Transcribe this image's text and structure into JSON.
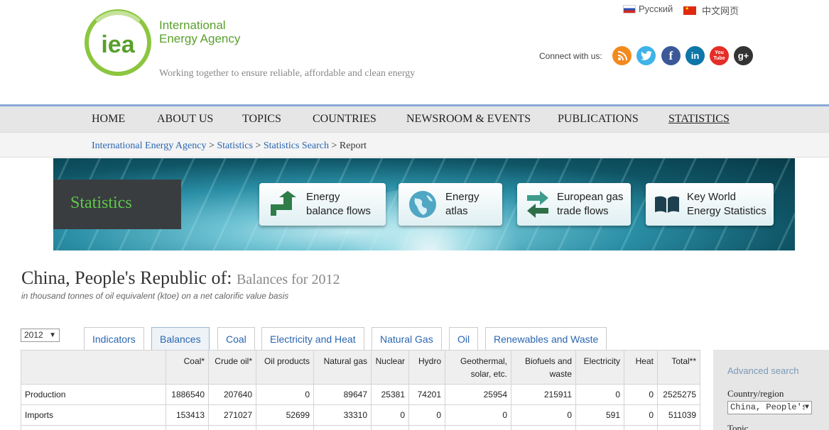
{
  "header": {
    "logo_text": "iea",
    "agency_name_line1": "International",
    "agency_name_line2": "Energy Agency",
    "tagline": "Working together to ensure reliable, affordable and clean energy",
    "lang_ru": "Русский",
    "lang_cn": "中文网页",
    "connect_label": "Connect with us:",
    "social_youtube": "You Tube",
    "social_google": "g+"
  },
  "nav": {
    "home": "HOME",
    "about": "ABOUT US",
    "topics": "TOPICS",
    "countries": "COUNTRIES",
    "newsroom": "NEWSROOM & EVENTS",
    "publications": "PUBLICATIONS",
    "statistics": "STATISTICS"
  },
  "breadcrumb": {
    "c1": "International Energy Agency",
    "c2": "Statistics",
    "c3": "Statistics Search",
    "c4": "Report",
    "sep": " > "
  },
  "banner": {
    "section": "Statistics",
    "b1_line1": "Energy",
    "b1_line2": "balance flows",
    "b2_line1": "Energy",
    "b2_line2": "atlas",
    "b3_line1": "European gas",
    "b3_line2": "trade flows",
    "b4_line1": "Key World",
    "b4_line2": "Energy Statistics"
  },
  "report": {
    "title": "China, People's Republic of:",
    "title_sub": "Balances for 2012",
    "subtitle": "in thousand tonnes of oil equivalent (ktoe) on a net calorific value basis",
    "year": "2012"
  },
  "tabs": {
    "t1": "Indicators",
    "t2": "Balances",
    "t3": "Coal",
    "t4": "Electricity and Heat",
    "t5": "Natural Gas",
    "t6": "Oil",
    "t7": "Renewables and Waste"
  },
  "table": {
    "h1": "Coal*",
    "h2": "Crude oil*",
    "h3": "Oil products",
    "h4": "Natural gas",
    "h5": "Nuclear",
    "h6": "Hydro",
    "h7a": "Geothermal,",
    "h7b": "solar, etc.",
    "h8a": "Biofuels and",
    "h8b": "waste",
    "h9": "Electricity",
    "h10": "Heat",
    "h11": "Total**",
    "r1": {
      "label": "Production",
      "v1": "1886540",
      "v2": "207640",
      "v3": "0",
      "v4": "89647",
      "v5": "25381",
      "v6": "74201",
      "v7": "25954",
      "v8": "215911",
      "v9": "0",
      "v10": "0",
      "v11": "2525275"
    },
    "r2": {
      "label": "Imports",
      "v1": "153413",
      "v2": "271027",
      "v3": "52699",
      "v4": "33310",
      "v5": "0",
      "v6": "0",
      "v7": "0",
      "v8": "0",
      "v9": "591",
      "v10": "0",
      "v11": "511039"
    }
  },
  "sidebar": {
    "advanced": "Advanced search",
    "country_label": "Country/region",
    "country_value": "China, People's Republic of",
    "topic_label": "Topic"
  },
  "colors": {
    "brand_green": "#5aa02c",
    "link_blue": "#2a66b0",
    "nav_top": "#8aa7d6"
  }
}
